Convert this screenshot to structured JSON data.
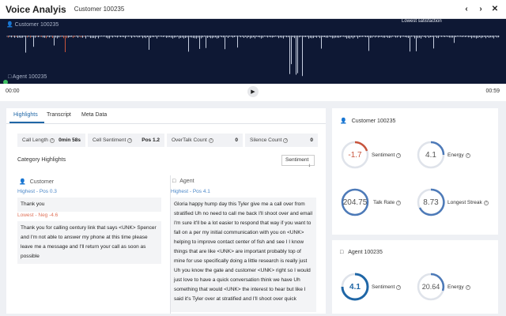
{
  "header": {
    "title": "Voice Analyis",
    "subtitle": "Customer 100235"
  },
  "audio": {
    "customer_label": "Customer 100235",
    "agent_label": "Agent 100235",
    "lowest_marker": "Lowest satisfaction",
    "time_start": "00:00",
    "time_end": "00:59"
  },
  "tabs": [
    "Highlights",
    "Transcript",
    "Meta Data"
  ],
  "stats": {
    "call_length_label": "Call Length",
    "call_length_value": "0min 58s",
    "cell_sentiment_label": "Cell Sentiment",
    "cell_sentiment_value": "Pos 1.2",
    "overtalk_label": "OverTalk Count",
    "overtalk_value": "0",
    "silence_label": "Silence Count",
    "silence_value": "0"
  },
  "category": {
    "title": "Category Highlights",
    "select_value": "Sentiment"
  },
  "customer_col": {
    "name": "Customer",
    "highest_label": "Highest - Pos 0.3",
    "highest_text": "Thank you",
    "lowest_label": "Lowest - Neg -4.6",
    "lowest_text": "Thank you for calling century link that says <UNK> Spencer and I'm not able to answer my phone at this time please leave me a message and I'll return your call as soon as possible"
  },
  "agent_col": {
    "name": "Agent",
    "highest_label": "Highest - Pos 4.1",
    "highest_text": "Gloria happy hump day this Tyler give me a call over from stratified Uh no need to call me back I'll shoot over and email I'm sure it'll be a lot easier to respond that way if you want to fall on a per my initial communication with you on <UNK> helping to improve contact center of fish and see I I know things that are like <UNK> are important probably top of mine for use specifically doing a little research is really just Uh you know the gate and customer <UNK> right so I would just love to have a quick conversation think we have Uh something that would <UNK> the interest to hear but like I said it's Tyler over at stratified and I'll shoot over quick"
  },
  "customer_panel": {
    "title": "Customer 100235",
    "sentiment": {
      "label": "Sentiment",
      "value": "-1.7"
    },
    "energy": {
      "label": "Energy",
      "value": "4.1"
    },
    "talk_rate": {
      "label": "Talk Rate",
      "value": "204.75"
    },
    "longest_streak": {
      "label": "Longest Streak",
      "value": "8.73"
    }
  },
  "agent_panel": {
    "title": "Agent 100235",
    "sentiment": {
      "label": "Sentiment",
      "value": "4.1"
    },
    "energy": {
      "label": "Energy",
      "value": "20.64"
    }
  },
  "colors": {
    "accent": "#1f66a6",
    "audio_bg": "#0e1834",
    "negative": "#c8543c",
    "gauge_track": "#dfe3ea",
    "gauge_blue": "#4d7ab8"
  }
}
